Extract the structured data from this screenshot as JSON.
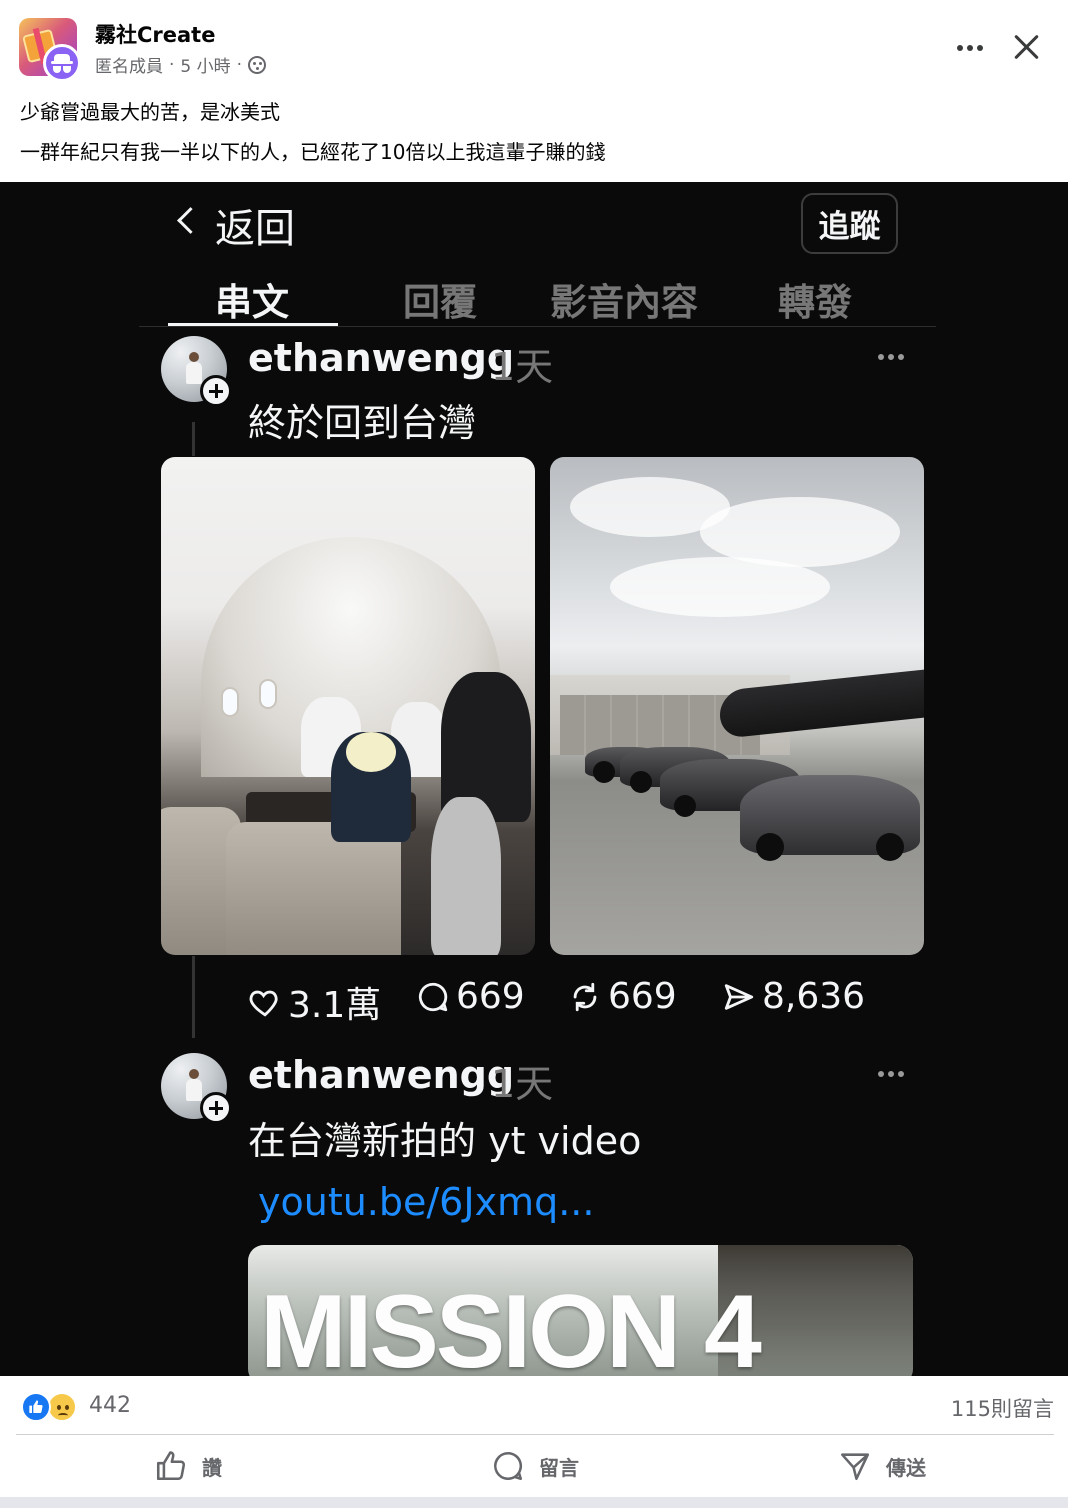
{
  "post": {
    "page_name": "霧社Create",
    "author_role": "匿名成員",
    "time_ago": "5 小時",
    "separator": "·",
    "text_line1": "少爺嘗過最大的苦，是冰美式",
    "text_line2": "一群年紀只有我一半以下的人，已經花了10倍以上我這輩子賺的錢"
  },
  "screenshot": {
    "back_label": "返回",
    "follow_label": "追蹤",
    "tabs": [
      {
        "label": "串文",
        "active": true
      },
      {
        "label": "回覆",
        "active": false
      },
      {
        "label": "影音內容",
        "active": false
      },
      {
        "label": "轉發",
        "active": false
      }
    ],
    "thread1": {
      "username": "ethanwengg",
      "time": "1天",
      "text": "終於回到台灣",
      "likes": "3.1萬",
      "comments": "669",
      "reposts": "669",
      "shares": "8,636"
    },
    "thread2": {
      "username": "ethanwengg",
      "time": "1天",
      "text": "在台灣新拍的 yt video",
      "link": "youtu.be/6Jxmq...",
      "card_title": "MISSION 4"
    }
  },
  "footer": {
    "reaction_count": "442",
    "comment_count": "115則留言",
    "like_label": "讚",
    "comment_label": "留言",
    "share_label": "傳送"
  },
  "colors": {
    "facebook_blue": "#1877f2",
    "threads_bg": "#0a0a0a",
    "link_blue": "#1d8cff",
    "anon_purple": "#8a63f5"
  }
}
